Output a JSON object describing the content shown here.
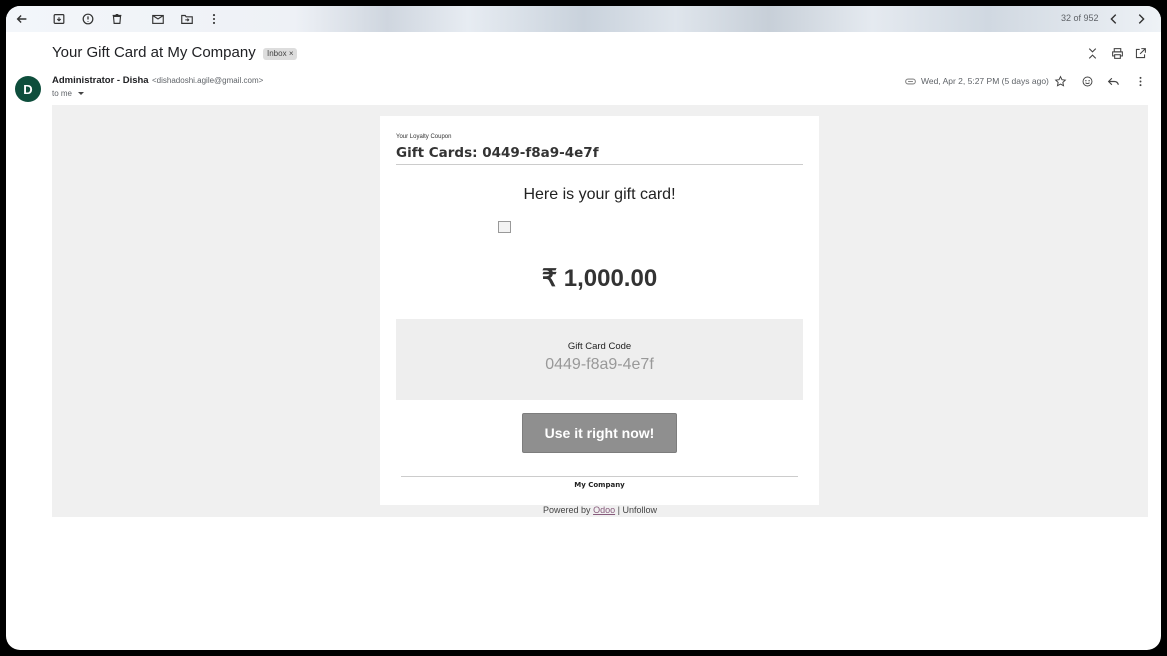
{
  "toolbar": {
    "icons": [
      "back-arrow-icon",
      "archive-icon",
      "report-spam-icon",
      "delete-icon",
      "mark-unread-icon",
      "move-to-icon",
      "more-vertical-icon"
    ],
    "pager": "32 of 952",
    "nav": [
      "chevron-left-icon",
      "chevron-right-icon"
    ]
  },
  "email": {
    "subject": "Your Gift Card at My Company",
    "label": "Inbox",
    "label_close": "×",
    "avatar_letter": "D",
    "sender_name": "Administrator - Disha",
    "sender_email": "<dishadoshi.agile@gmail.com>",
    "to": "to me",
    "date": "Wed, Apr 2, 5:27 PM (5 days ago)"
  },
  "body": {
    "coupon_heading": "Your Loyalty Coupon",
    "title": "Gift Cards: 0449-f8a9-4e7f",
    "greeting": "Here is your gift card!",
    "amount": "₹ 1,000.00",
    "code_label": "Gift Card Code",
    "code_value": "0449-f8a9-4e7f",
    "cta": "Use it right now!",
    "company": "My Company"
  },
  "footer": {
    "powered_by": "Powered by",
    "odoo": "Odoo",
    "separator": "|",
    "unfollow": "Unfollow"
  },
  "colors": {
    "avatar": "#0e4e3c",
    "cta_bg": "#8f8f8f",
    "link": "#875a7b"
  }
}
